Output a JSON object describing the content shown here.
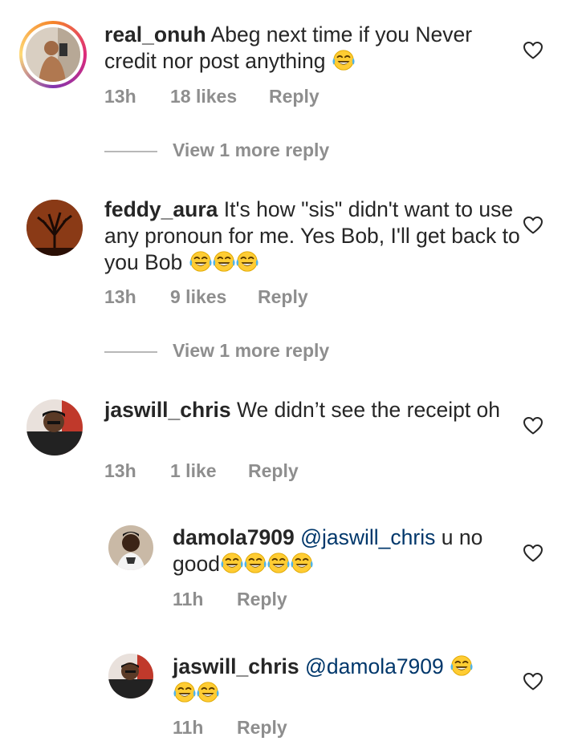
{
  "comments": [
    {
      "username": "real_onuh",
      "text": "Abeg next time if you Never credit nor post anything",
      "emoji_count": 1,
      "time": "13h",
      "likes": "18 likes",
      "reply_label": "Reply",
      "view_more": "View 1 more reply"
    },
    {
      "username": "feddy_aura",
      "text": "It's how \"sis\" didn't want to use any pronoun for me. Yes Bob, I'll get back to you Bob",
      "emoji_count": 3,
      "time": "13h",
      "likes": "9 likes",
      "reply_label": "Reply",
      "view_more": "View 1 more reply"
    },
    {
      "username": "jaswill_chris",
      "text": "We didn’t see the receipt oh",
      "time": "13h",
      "likes": "1 like",
      "reply_label": "Reply"
    }
  ],
  "replies": [
    {
      "username": "damola7909",
      "mention": "@jaswill_chris",
      "text_line1": "u no",
      "text_line2": "good",
      "emoji_count": 4,
      "time": "11h",
      "reply_label": "Reply"
    },
    {
      "username": "jaswill_chris",
      "mention": "@damola7909",
      "emoji_count": 3,
      "time": "11h",
      "reply_label": "Reply"
    }
  ],
  "icons": {
    "like": "heart-outline-icon",
    "emoji": "face-with-tears-of-joy-emoji"
  },
  "colors": {
    "text": "#262626",
    "meta": "#8e8e8e",
    "mention": "#00376b",
    "emoji_face": "#ffcc33",
    "emoji_tears": "#4fb3e8"
  }
}
